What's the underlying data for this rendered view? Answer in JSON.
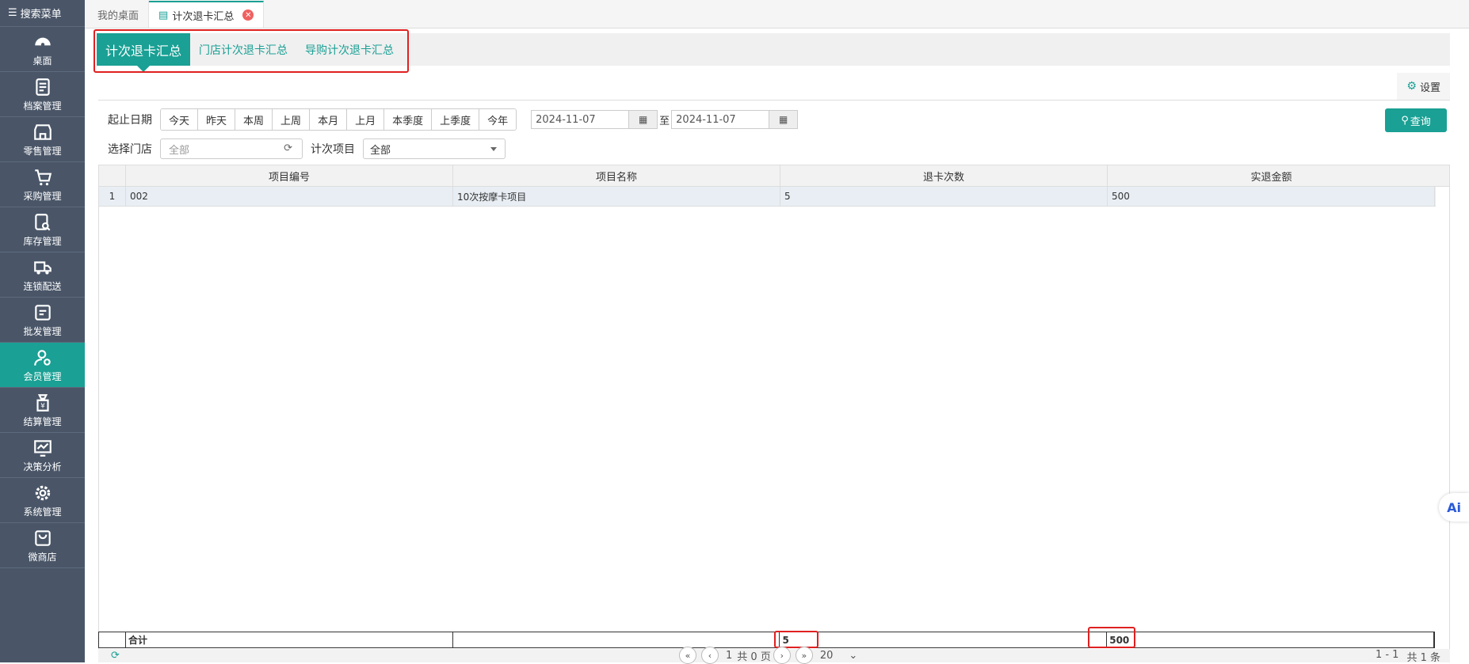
{
  "sidebar": {
    "search_label": "搜索菜单",
    "items": [
      {
        "label": "桌面",
        "icon": "dashboard-icon"
      },
      {
        "label": "档案管理",
        "icon": "archive-icon"
      },
      {
        "label": "零售管理",
        "icon": "store-icon"
      },
      {
        "label": "采购管理",
        "icon": "cart-icon"
      },
      {
        "label": "库存管理",
        "icon": "inventory-icon"
      },
      {
        "label": "连锁配送",
        "icon": "truck-icon"
      },
      {
        "label": "批发管理",
        "icon": "wholesale-icon"
      },
      {
        "label": "会员管理",
        "icon": "member-icon",
        "active": true
      },
      {
        "label": "结算管理",
        "icon": "money-bag-icon"
      },
      {
        "label": "决策分析",
        "icon": "analytics-icon"
      },
      {
        "label": "系统管理",
        "icon": "settings-icon"
      },
      {
        "label": "微商店",
        "icon": "shop-bag-icon"
      }
    ]
  },
  "tabs": {
    "desktop": "我的桌面",
    "current": "计次退卡汇总"
  },
  "subtabs": [
    "计次退卡汇总",
    "门店计次退卡汇总",
    "导购计次退卡汇总"
  ],
  "settings_label": "设置",
  "filters": {
    "date_label": "起止日期",
    "quick_dates": [
      "今天",
      "昨天",
      "本周",
      "上周",
      "本月",
      "上月",
      "本季度",
      "上季度",
      "今年"
    ],
    "start_date": "2024-11-07",
    "to_label": "至",
    "end_date": "2024-11-07",
    "store_label": "选择门店",
    "store_placeholder": "全部",
    "item_label": "计次项目",
    "item_value": "全部",
    "query_label": "查询"
  },
  "table": {
    "columns": [
      "项目编号",
      "项目名称",
      "退卡次数",
      "实退金额"
    ],
    "rows": [
      {
        "index": "1",
        "code": "002",
        "name": "10次按摩卡项目",
        "count": "5",
        "amount": "500"
      }
    ],
    "summary": {
      "label": "合计",
      "count": "5",
      "amount": "500"
    }
  },
  "pager": {
    "page": "1",
    "total_pages_label": "共 0 页",
    "page_size": "20",
    "range": "1 - 1",
    "total_label": "共 1 条"
  },
  "colors": {
    "accent": "#1aa094",
    "sidebar": "#4a5668",
    "highlight": "#e02020"
  }
}
